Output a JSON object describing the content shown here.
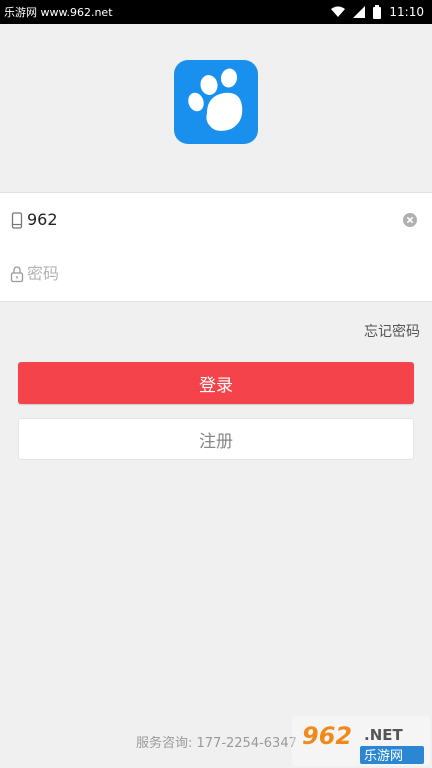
{
  "status_bar": {
    "watermark": "乐游网 www.962.net",
    "time": "11:10",
    "icons": [
      "wifi-icon",
      "signal-icon",
      "battery-icon"
    ]
  },
  "app": {
    "logo_icon": "paw-icon",
    "accent": "#1990ee"
  },
  "form": {
    "phone_value": "962",
    "password_placeholder": "密码",
    "forgot_label": "忘记密码",
    "login_label": "登录",
    "register_label": "注册"
  },
  "footer": {
    "service_text": "服务咨询: 177-2254-6347",
    "watermark_brand": "962.NET",
    "watermark_cn": "乐游网"
  },
  "colors": {
    "login_button": "#f5434b",
    "background": "#f0f0f0"
  }
}
